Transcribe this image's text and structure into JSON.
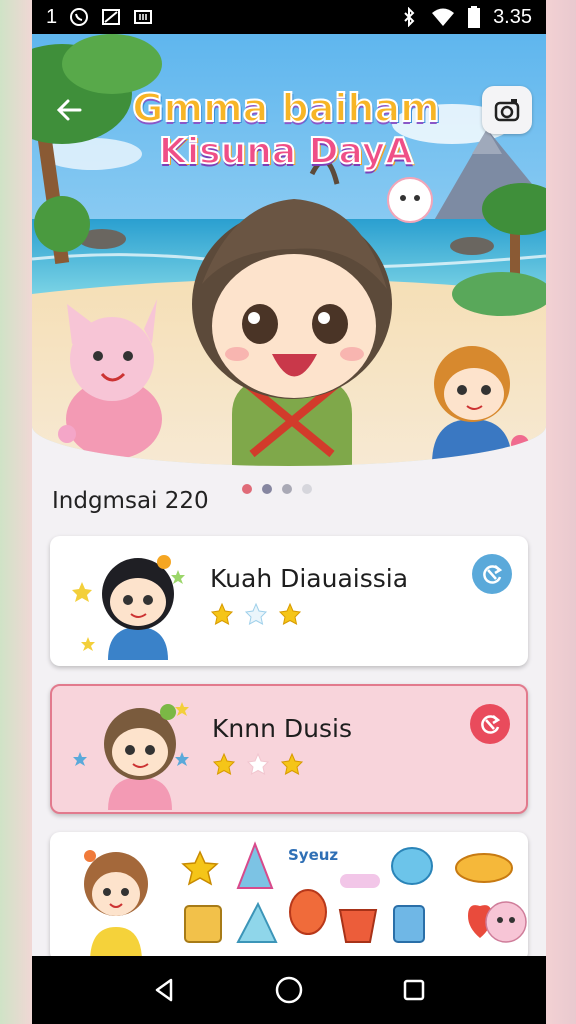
{
  "status_bar": {
    "left_number": "1",
    "time": "3.35",
    "icons": [
      "whatsapp-icon",
      "image-icon",
      "grid-icon",
      "bluetooth-icon",
      "wifi-icon",
      "battery-icon"
    ]
  },
  "hero": {
    "title_line1": "Gmma baiham",
    "title_line2": "Kisuna DayA",
    "carousel_total": 4,
    "carousel_active": 1
  },
  "section_title": "Indgmsai 220",
  "cards": [
    {
      "name": "Kuah Diauaissia",
      "rating": 2,
      "max_rating": 3,
      "action_icon": "refresh-icon",
      "accent": "#5aa9da"
    },
    {
      "name": "Knnn Dusis",
      "rating": 2,
      "max_rating": 3,
      "action_icon": "refresh-icon",
      "accent": "#e94b5c",
      "selected": true
    }
  ],
  "sticker_card": {
    "label": "Syeuz",
    "stickers": [
      "girl-sticker",
      "star-sticker",
      "party-hat-sticker",
      "label-sticker",
      "speech-bubble-sticker",
      "taco-sticker",
      "bag-sticker",
      "cone-sticker",
      "fruit-sticker",
      "pot-sticker",
      "notepad-sticker",
      "heart-sticker",
      "cat-sticker"
    ]
  },
  "colors": {
    "accent_blue": "#5aa9da",
    "accent_red": "#e94b5c",
    "selected_card_bg": "#f8d4db",
    "selected_card_border": "#e27a8d"
  }
}
